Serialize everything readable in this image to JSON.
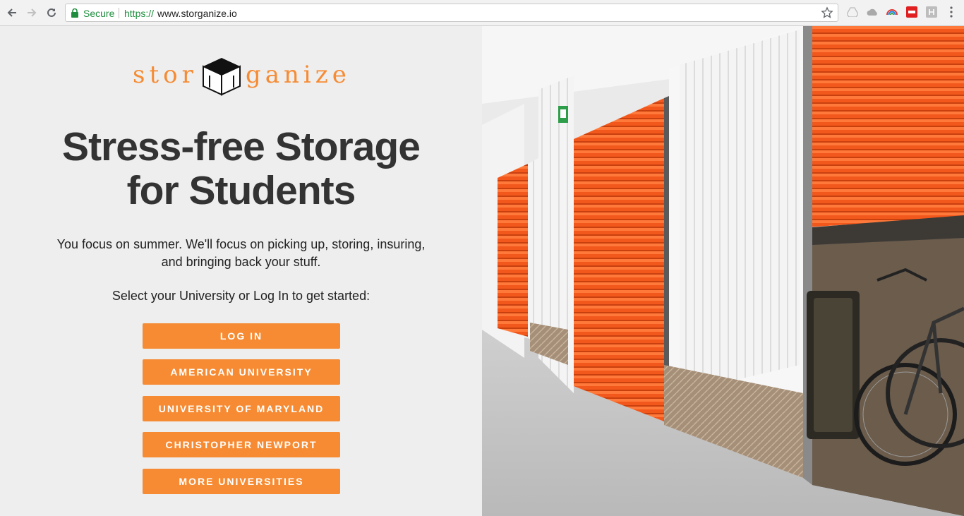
{
  "browser": {
    "secure_label": "Secure",
    "url_scheme": "https://",
    "url_host": "www.storganize.io"
  },
  "brand": {
    "logo_left": "stor",
    "logo_right": "ganize",
    "accent": "#f68b33"
  },
  "hero": {
    "headline_line1": "Stress-free Storage",
    "headline_line2": "for Students",
    "subtext_line1": "You focus on summer. We'll focus on picking up, storing, insuring,",
    "subtext_line2": "and bringing back your stuff.",
    "prompt": "Select your University or Log In to get started:"
  },
  "buttons": {
    "login": "LOG IN",
    "american": "AMERICAN UNIVERSITY",
    "maryland": "UNIVERSITY OF MARYLAND",
    "newport": "CHRISTOPHER NEWPORT",
    "more": "MORE UNIVERSITIES"
  },
  "image": {
    "icon": "storage-units-photo"
  }
}
